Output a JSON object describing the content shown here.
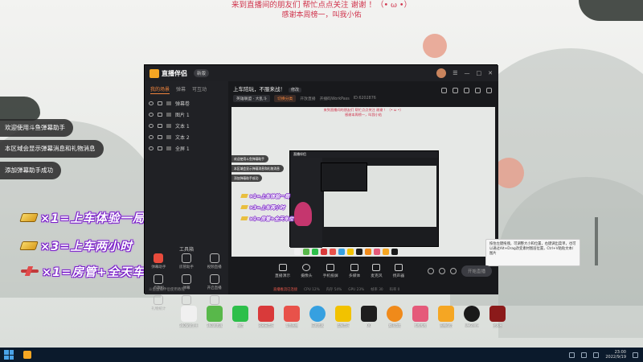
{
  "banner": {
    "line1": "来到直播间的朋友们 帮忙点点关注 谢谢 ！（• ω •）",
    "line2": "感谢本周榜一，叫我小佑"
  },
  "notices": [
    "欢迎使用斗鱼弹幕助手",
    "本区域会显示弹幕消息和礼物消息",
    "添加弹幕助手成功"
  ],
  "rules": [
    {
      "icon": "gold-card-icon",
      "text": "×1=上车体验一局"
    },
    {
      "icon": "gold-card-icon",
      "text": "×3=上车两小时"
    },
    {
      "icon": "airplane-gift-icon",
      "text": "×1=房管+全天车位"
    }
  ],
  "app": {
    "name": "直播伴侣",
    "version_badge": "新版",
    "sidebar_tabs": [
      "我的场景",
      "弹幕",
      "可互动"
    ],
    "layers": [
      "弹幕卷",
      "图片 1",
      "文本 1",
      "文本 2",
      "全屏 1"
    ],
    "tools_title": "工具箱",
    "tools": [
      "弹幕助手",
      "房管助手",
      "视频直播",
      "点歌机",
      "弹幕",
      "开启直播",
      "礼物统计",
      "",
      "主播任务",
      "",
      "",
      ""
    ],
    "sidebar_footer": "斗鱼直播伴侣使用教程",
    "room_title": "上车陪玩，不服来战！",
    "room_title_edit": "修改",
    "room_category": "英雄联盟 · 大乱斗",
    "room_category_btn": "切换分类",
    "room_meta": [
      "开放直播",
      "开播码WorkPass",
      "ID:6202876"
    ],
    "controls": [
      "直播演示",
      "摄像头",
      "手机投屏",
      "多媒体",
      "麦克风",
      "扬声器"
    ],
    "live_button": "开始直播",
    "statusbar": [
      "直播推流已连接",
      "CPU 12%",
      "内存 54%",
      "GPU 23%",
      "帧率 30",
      "码率 0"
    ],
    "tip_text": "按住左键拖拽，可调整大小和位置，右键调出菜单，也可以通过Alt+Drag改变素材图层位置，Ctrl+V粘贴文本/图片",
    "preview_notices": [
      "欢迎使用斗鱼弹幕助手",
      "本区域会显示弹幕消息和礼物消息",
      "添加弹幕助手成功"
    ],
    "preview_rules": [
      "×1=上车体验一局",
      "×3=上车两小时",
      "×1=房管+全天车位"
    ]
  },
  "desktop_icons": [
    {
      "label": "360安全卫士",
      "color": "#f0f0f0"
    },
    {
      "label": "360浏览器",
      "color": "#58b84a"
    },
    {
      "label": "微信",
      "color": "#2dbf4a"
    },
    {
      "label": "网易云音乐",
      "color": "#d93a3a"
    },
    {
      "label": "斗鱼直播",
      "color": "#e8524a"
    },
    {
      "label": "IE浏览器",
      "color": "#36a0e0"
    },
    {
      "label": "酷狗音乐",
      "color": "#f2c200"
    },
    {
      "label": "QQ",
      "color": "#1e1e1e"
    },
    {
      "label": "腾讯游戏",
      "color": "#f08a1a"
    },
    {
      "label": "哔哩哔哩",
      "color": "#e55a7a"
    },
    {
      "label": "直播伴侣",
      "color": "#f5a623"
    },
    {
      "label": "WeGame",
      "color": "#1a1a1a"
    },
    {
      "label": "逆水寒",
      "color": "#8b1a1a"
    }
  ],
  "taskbar": {
    "time": "23:00",
    "date": "2022/9/19"
  }
}
